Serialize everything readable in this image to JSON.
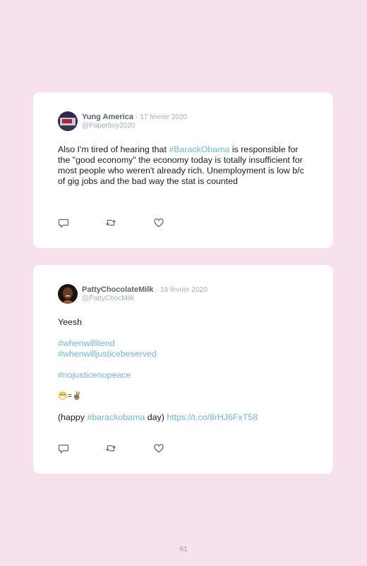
{
  "tweets": [
    {
      "name": "Yung America",
      "separator": "·",
      "date": "17 février 2020",
      "handle": "@Paperboy2020",
      "text": {
        "part1": "Also I'm tired of hearing that ",
        "hashtag": "#BarackObama",
        "part2": " is responsible for the \"good economy\" the economy today is totally insufficient for most people who weren't already rich. Unemployment is low b/c of gig jobs and the bad way the stat is counted"
      },
      "actions": {
        "reply": "reply-icon",
        "retweet": "retweet-icon",
        "like": "heart-icon"
      }
    },
    {
      "name": "PattyChocolateMilk",
      "separator": "·",
      "date": "18 février 2020",
      "handle": "@PattyChocMilk",
      "text": {
        "line1": "Yeesh",
        "hashtag1": "#whenwillitend",
        "hashtag2": "#whenwilljusticebeserved",
        "hashtag3": "#nojusticenopeace",
        "emoji_line": "😷=✌🏽",
        "line_open": "(happy ",
        "hashtag4": "#barackobama",
        "line_mid": " day) ",
        "link": "https://t.co/8rHJ6FxT58"
      },
      "actions": {
        "reply": "reply-icon",
        "retweet": "retweet-icon",
        "like": "heart-icon"
      }
    }
  ],
  "page_number": "61",
  "colors": {
    "background": "#f7e1ec",
    "card": "#ffffff",
    "hashtag": "#6fb6e8",
    "meta": "#a8aeb5"
  }
}
